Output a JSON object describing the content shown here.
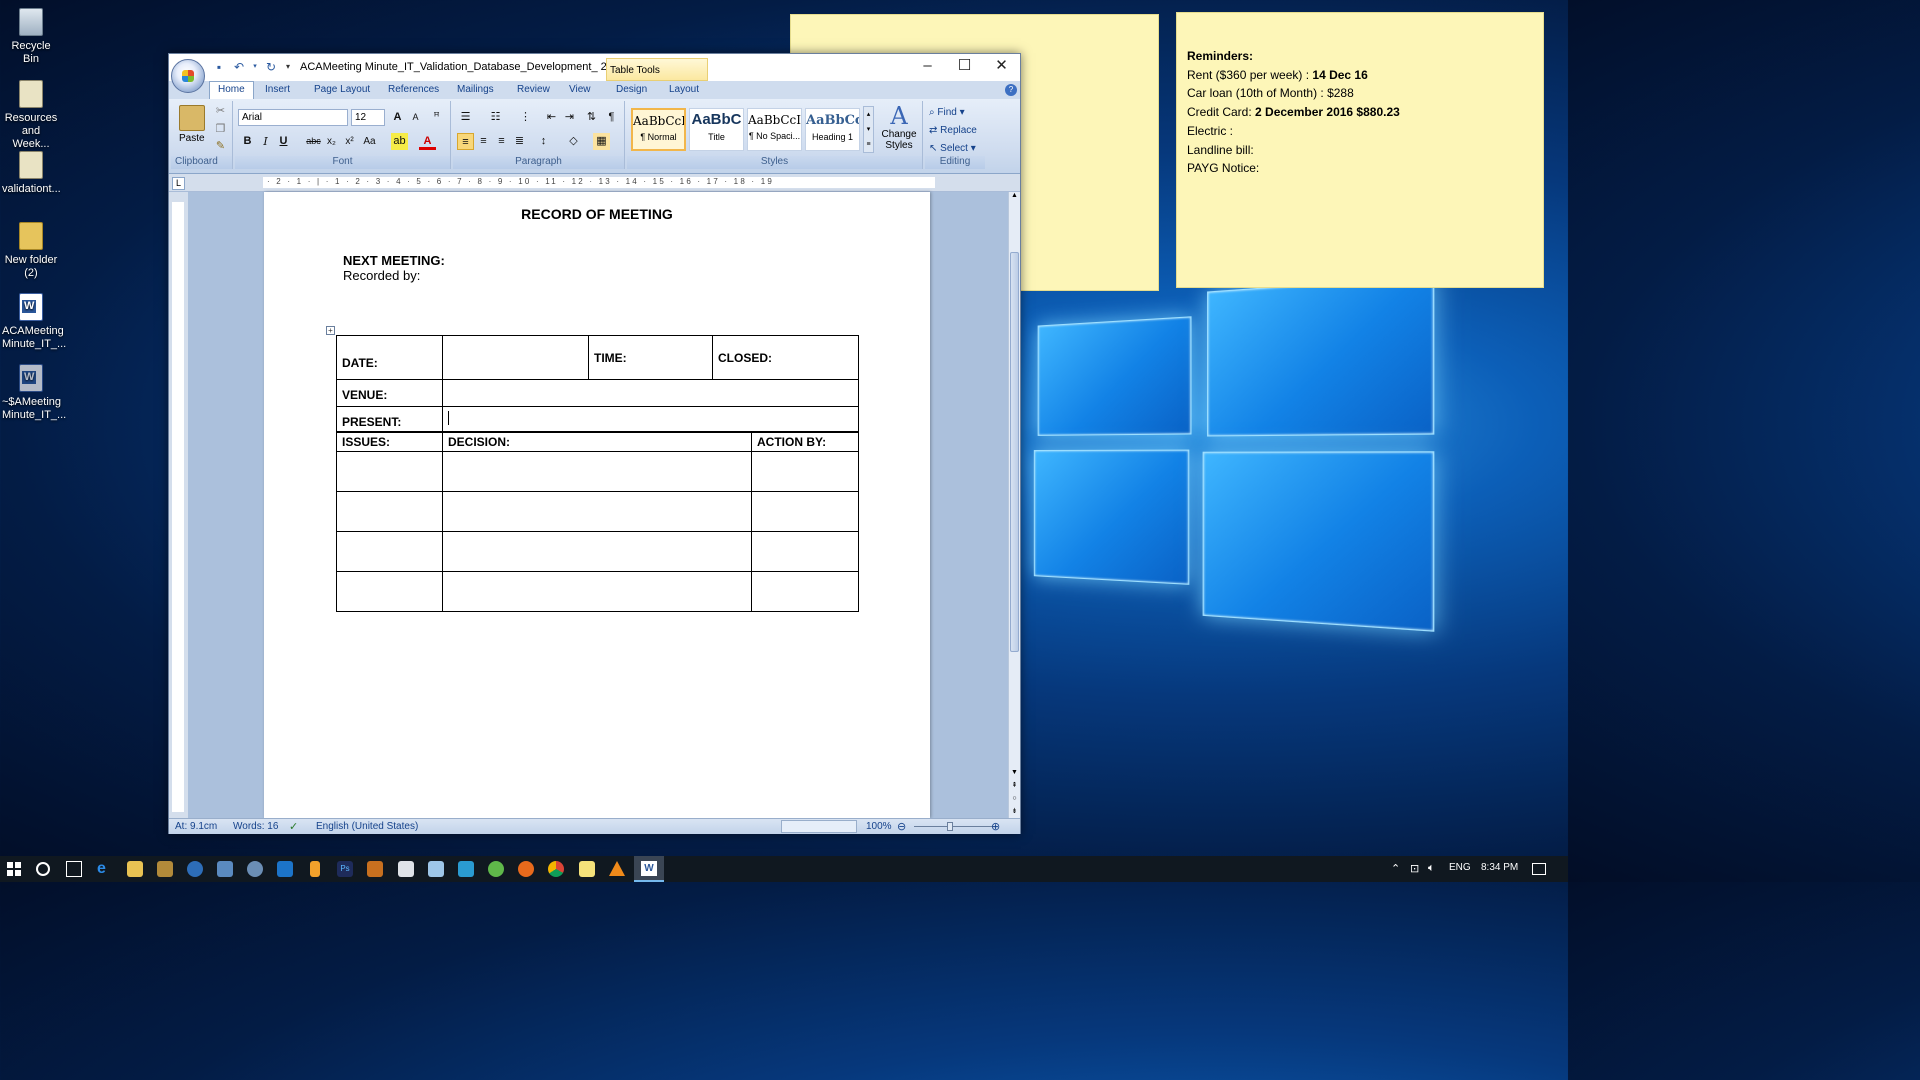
{
  "desktop": {
    "icons": [
      {
        "label": "Recycle Bin"
      },
      {
        "label": "Resources and Week..."
      },
      {
        "label": "validationt..."
      },
      {
        "label": "New folder (2)"
      },
      {
        "label": "ACAMeeting Minute_IT_..."
      },
      {
        "label": "~$AMeeting Minute_IT_..."
      }
    ]
  },
  "sticky_note_2": {
    "heading": "Reminders:",
    "rows": [
      {
        "label": "Rent ($360 per week) : ",
        "value": "14 Dec 16"
      },
      {
        "label": "Car loan (10th of Month) : $288",
        "value": ""
      },
      {
        "label": "Credit Card: ",
        "value": "2 December 2016 $880.23"
      },
      {
        "label": "Electric :",
        "value": ""
      },
      {
        "label": "Landline bill:",
        "value": ""
      },
      {
        "label": "PAYG Notice:",
        "value": ""
      }
    ]
  },
  "word": {
    "title": "ACAMeeting Minute_IT_Validation_Database_Development_ 26 Ma...",
    "table_tools": "Table Tools",
    "tabs": [
      "Home",
      "Insert",
      "Page Layout",
      "References",
      "Mailings",
      "Review",
      "View",
      "Design",
      "Layout"
    ],
    "active_tab": "Home",
    "ribbon": {
      "clipboard": {
        "label": "Clipboard",
        "paste": "Paste"
      },
      "font": {
        "label": "Font",
        "family": "Arial",
        "size": "12"
      },
      "paragraph": {
        "label": "Paragraph"
      },
      "styles": {
        "label": "Styles",
        "items": [
          {
            "preview": "AaBbCcI",
            "name": "¶ Normal"
          },
          {
            "preview": "AaBbC",
            "name": "Title"
          },
          {
            "preview": "AaBbCcI",
            "name": "¶ No Spaci..."
          },
          {
            "preview": "AaBbCc",
            "name": "Heading 1"
          }
        ],
        "change": "Change Styles"
      },
      "editing": {
        "label": "Editing",
        "find": "Find",
        "replace": "Replace",
        "select": "Select"
      }
    },
    "ruler_text": "· 2 · 1 · | · 1 · 2 · 3 · 4 · 5 · 6 · 7 · 8 · 9 · 10 · 11 · 12 · 13 · 14 · 15 · 16 · 17 · 18 · 19",
    "document": {
      "title": "RECORD OF MEETING",
      "next_meeting": "NEXT MEETING:",
      "recorded_by": "Recorded by:",
      "table": {
        "date": "DATE:",
        "time": "TIME:",
        "closed": "CLOSED:",
        "venue": "VENUE:",
        "present": "PRESENT:",
        "issues": "ISSUES:",
        "decision": "DECISION:",
        "action_by": "ACTION BY:"
      }
    },
    "status": {
      "at": "At: 9.1cm",
      "words": "Words: 16",
      "language": "English (United States)",
      "zoom": "100%"
    }
  },
  "taskbar": {
    "lang": "ENG",
    "time": "8:34 PM"
  }
}
